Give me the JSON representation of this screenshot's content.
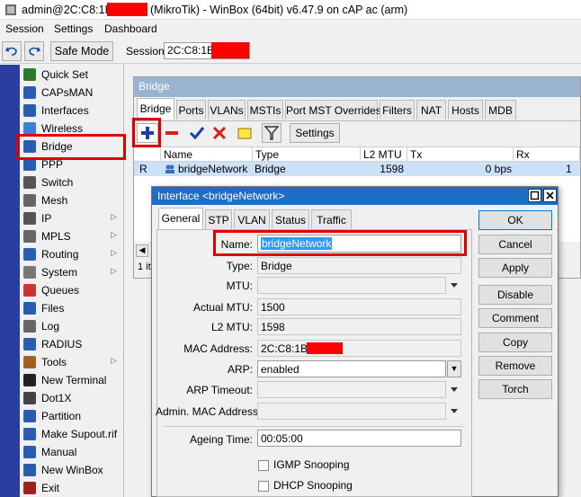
{
  "window": {
    "title_prefix": "admin@2C:C8:1B:",
    "title_suffix": "(MikroTik) - WinBox (64bit) v6.47.9 on cAP ac (arm)"
  },
  "menu": [
    "Session",
    "Settings",
    "Dashboard"
  ],
  "toolbar": {
    "undo_icon": "undo-icon",
    "redo_icon": "redo-icon",
    "safe_mode": "Safe Mode",
    "session_label": "Session:",
    "session_value": "2C:C8:1B:"
  },
  "sidebar": {
    "items": [
      {
        "label": "Quick Set",
        "icon": "quickset-icon",
        "arrow": false
      },
      {
        "label": "CAPsMAN",
        "icon": "capsman-icon",
        "arrow": false
      },
      {
        "label": "Interfaces",
        "icon": "interfaces-icon",
        "arrow": false
      },
      {
        "label": "Wireless",
        "icon": "wireless-icon",
        "arrow": false
      },
      {
        "label": "Bridge",
        "icon": "bridge-icon",
        "arrow": false
      },
      {
        "label": "PPP",
        "icon": "ppp-icon",
        "arrow": false
      },
      {
        "label": "Switch",
        "icon": "switch-icon",
        "arrow": false
      },
      {
        "label": "Mesh",
        "icon": "mesh-icon",
        "arrow": false
      },
      {
        "label": "IP",
        "icon": "ip-icon",
        "arrow": true
      },
      {
        "label": "MPLS",
        "icon": "mpls-icon",
        "arrow": true
      },
      {
        "label": "Routing",
        "icon": "routing-icon",
        "arrow": true
      },
      {
        "label": "System",
        "icon": "system-icon",
        "arrow": true
      },
      {
        "label": "Queues",
        "icon": "queues-icon",
        "arrow": false
      },
      {
        "label": "Files",
        "icon": "files-icon",
        "arrow": false
      },
      {
        "label": "Log",
        "icon": "log-icon",
        "arrow": false
      },
      {
        "label": "RADIUS",
        "icon": "radius-icon",
        "arrow": false
      },
      {
        "label": "Tools",
        "icon": "tools-icon",
        "arrow": true
      },
      {
        "label": "New Terminal",
        "icon": "terminal-icon",
        "arrow": false
      },
      {
        "label": "Dot1X",
        "icon": "dot1x-icon",
        "arrow": false
      },
      {
        "label": "Partition",
        "icon": "partition-icon",
        "arrow": false
      },
      {
        "label": "Make Supout.rif",
        "icon": "supout-icon",
        "arrow": false
      },
      {
        "label": "Manual",
        "icon": "manual-icon",
        "arrow": false
      },
      {
        "label": "New WinBox",
        "icon": "winbox-icon",
        "arrow": false
      },
      {
        "label": "Exit",
        "icon": "exit-icon",
        "arrow": false
      }
    ]
  },
  "bridge_window": {
    "title": "Bridge",
    "tabs": [
      "Bridge",
      "Ports",
      "VLANs",
      "MSTIs",
      "Port MST Overrides",
      "Filters",
      "NAT",
      "Hosts",
      "MDB"
    ],
    "active_tab": "Bridge",
    "settings_button": "Settings",
    "columns": [
      "Name",
      "Type",
      "L2 MTU",
      "Tx",
      "Rx"
    ],
    "rows": [
      {
        "flag": "R",
        "name": "bridgeNetwork",
        "type": "Bridge",
        "l2mtu": "1598",
        "tx": "0 bps",
        "rx": "1"
      }
    ],
    "status": "1 it"
  },
  "dialog": {
    "title": "Interface <bridgeNetwork>",
    "tabs": [
      "General",
      "STP",
      "VLAN",
      "Status",
      "Traffic"
    ],
    "active_tab": "General",
    "fields": {
      "name_label": "Name:",
      "name_value": "bridgeNetwork",
      "type_label": "Type:",
      "type_value": "Bridge",
      "mtu_label": "MTU:",
      "mtu_value": "",
      "actual_mtu_label": "Actual MTU:",
      "actual_mtu_value": "1500",
      "l2mtu_label": "L2 MTU:",
      "l2mtu_value": "1598",
      "mac_label": "MAC Address:",
      "mac_value": "2C:C8:1B:",
      "arp_label": "ARP:",
      "arp_value": "enabled",
      "arp_timeout_label": "ARP Timeout:",
      "arp_timeout_value": "",
      "admin_mac_label": "Admin. MAC Address:",
      "admin_mac_value": "",
      "ageing_label": "Ageing Time:",
      "ageing_value": "00:05:00",
      "igmp_label": "IGMP Snooping",
      "dhcp_label": "DHCP Snooping"
    },
    "buttons": [
      "OK",
      "Cancel",
      "Apply",
      "Disable",
      "Comment",
      "Copy",
      "Remove",
      "Torch"
    ]
  },
  "colors": {
    "highlight_red": "#e00000",
    "selection_blue": "#3399ff",
    "dialog_title": "#1e6ec8",
    "sidebar_band": "#2a3ea0"
  }
}
